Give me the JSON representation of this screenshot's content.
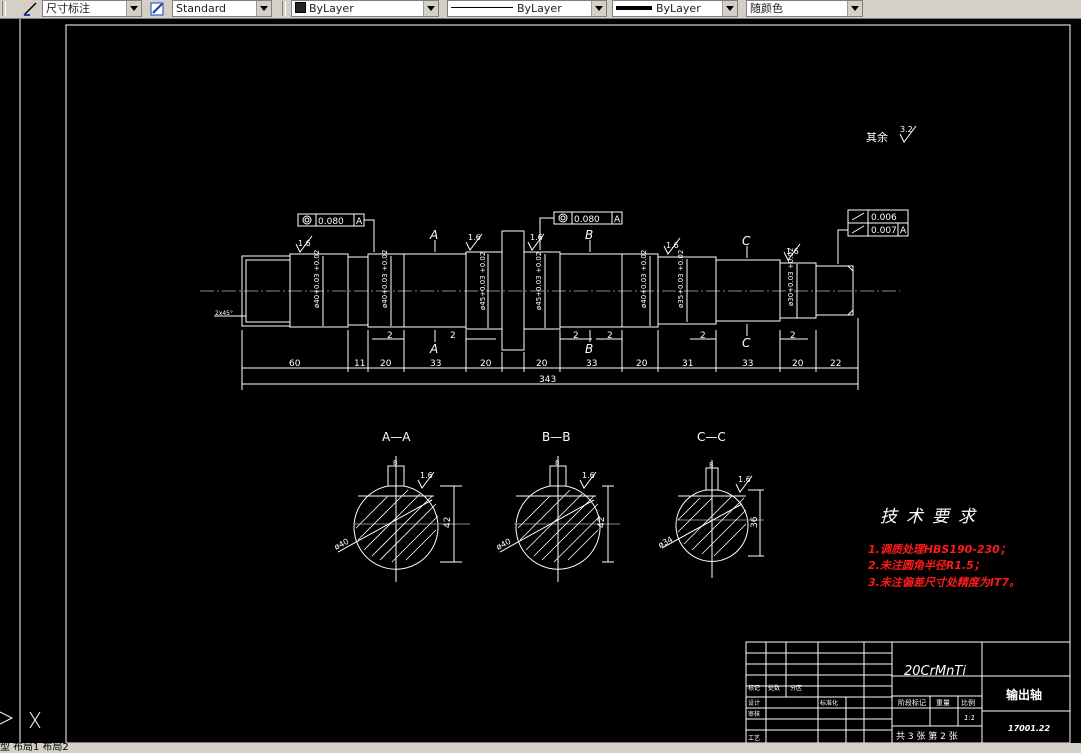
{
  "toolbar": {
    "dim_style": "尺寸标注",
    "text_style": "Standard",
    "layer_color": "ByLayer",
    "linetype": "ByLayer",
    "lineweight": "ByLayer",
    "plot_color": "随颜色"
  },
  "drawing": {
    "roughness_rest_label": "其余",
    "roughness_rest_value": "3.2",
    "roughness_values": [
      "1.6",
      "1.6",
      "1.6",
      "1.6",
      "1.6",
      "1.6",
      "1.6",
      "1.6"
    ],
    "tolerance_1": "0.080",
    "tolerance_1_datum": "A",
    "tolerance_2": "0.080",
    "tolerance_2_datum": "A",
    "tolerance_3a": "0.006",
    "tolerance_3b": "0.007",
    "tolerance_3_datum": "A",
    "chamfer": "2x45°",
    "section_letters": [
      "A",
      "A",
      "B",
      "B",
      "C",
      "C"
    ],
    "diameters": [
      "ø40+0.03 +0.02",
      "ø40+0.03 +0.02",
      "ø45+0.03 +0.02",
      "ø45+0.03 +0.02",
      "ø40+0.03 +0.02",
      "ø35+0.03 +0.02",
      "ø30+0.03 +0.02"
    ],
    "lengths": [
      "60",
      "11",
      "20",
      "33",
      "20",
      "20",
      "33",
      "20",
      "31",
      "33",
      "20",
      "22"
    ],
    "small_dims": [
      "2",
      "2",
      "2",
      "2",
      "2",
      "2"
    ],
    "total_length": "343"
  },
  "sections": [
    {
      "title": "A—A",
      "key": "8",
      "rough": "1.6",
      "diam": "ø40",
      "height": "42"
    },
    {
      "title": "B—B",
      "key": "8",
      "rough": "1.6",
      "diam": "ø40",
      "height": "42"
    },
    {
      "title": "C—C",
      "key": "8",
      "rough": "1.6",
      "diam": "ø34",
      "height": "36"
    }
  ],
  "requirements": {
    "title": "技术要求",
    "items": [
      "1.调质处理HBS190-230；",
      "2.未注圆角半径R1.5；",
      "3.未注偏差尺寸处精度为IT7。"
    ]
  },
  "title_block": {
    "material": "20CrMnTi",
    "part_name": "输出轴",
    "drawing_no": "17001.22",
    "row_labels": [
      "标记",
      "处数",
      "分区",
      "设计",
      "标准化",
      "审核",
      "工艺"
    ],
    "stage_label": "阶段标记",
    "weight_label": "重量",
    "scale_label": "比例",
    "scale_value": "1:1",
    "sheet_text": "共 3 张    第 2 张"
  },
  "layout_tabs": [
    "型",
    "布局1",
    "布局2"
  ],
  "colors": {
    "background": "#000000",
    "lines": "#ffffff",
    "requirements_text": "#ff1a1a"
  }
}
